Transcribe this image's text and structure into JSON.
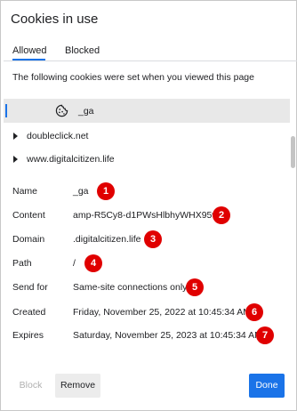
{
  "dialog": {
    "title": "Cookies in use",
    "tabs": [
      {
        "label": "Allowed",
        "active": true
      },
      {
        "label": "Blocked",
        "active": false
      }
    ],
    "info_text": "The following cookies were set when you viewed this page"
  },
  "tree": {
    "selected_cookie": {
      "name": "_ga",
      "icon": "cookie-icon"
    },
    "sites": [
      {
        "label": "doubleclick.net",
        "icon": "expand-arrow-icon"
      },
      {
        "label": "www.digitalcitizen.life",
        "icon": "expand-arrow-icon"
      }
    ]
  },
  "details": {
    "name": {
      "label": "Name",
      "value": "_ga",
      "badge": "1"
    },
    "content": {
      "label": "Content",
      "value": "amp-R5Cy8-d1PWsHlbhyWHX95w",
      "badge": "2"
    },
    "domain": {
      "label": "Domain",
      "value": ".digitalcitizen.life",
      "badge": "3"
    },
    "path": {
      "label": "Path",
      "value": "/",
      "badge": "4"
    },
    "send_for": {
      "label": "Send for",
      "value": "Same-site connections only",
      "badge": "5"
    },
    "created": {
      "label": "Created",
      "value": "Friday, November 25, 2022 at 10:45:34 AM",
      "badge": "6"
    },
    "expires": {
      "label": "Expires",
      "value": "Saturday, November 25, 2023 at 10:45:34 AM",
      "badge": "7"
    }
  },
  "buttons": {
    "block": "Block",
    "remove": "Remove",
    "done": "Done"
  },
  "colors": {
    "accent": "#1a73e8",
    "badge": "#e00000",
    "selected_row": "#e8e8e8"
  }
}
